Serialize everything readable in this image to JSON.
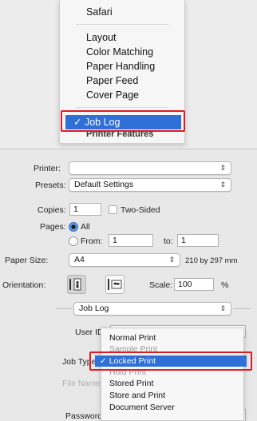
{
  "menu": {
    "items": [
      "Safari",
      "Layout",
      "Color Matching",
      "Paper Handling",
      "Paper Feed",
      "Cover Page"
    ],
    "selected": "Job Log",
    "after": "Printer Features"
  },
  "dialog": {
    "printer_label": "Printer:",
    "printer_value": "",
    "presets_label": "Presets:",
    "presets_value": "Default Settings",
    "copies_label": "Copies:",
    "copies_value": "1",
    "two_sided_label": "Two-Sided",
    "pages_label": "Pages:",
    "pages_all": "All",
    "pages_from_label": "From:",
    "pages_from_value": "1",
    "pages_to_label": "to:",
    "pages_to_value": "1",
    "paper_size_label": "Paper Size:",
    "paper_size_value": "A4",
    "paper_size_dims": "210 by 297 mm",
    "orientation_label": "Orientation:",
    "scale_label": "Scale:",
    "scale_value": "100",
    "scale_unit": "%",
    "section_value": "Job Log",
    "user_id_label": "User ID",
    "job_type_label": "Job Type",
    "file_name_label": "File Name",
    "password_label": "Password"
  },
  "job_type_dropdown": {
    "items": [
      "Normal Print",
      "Sample Print",
      "Locked Print",
      "Hold Print",
      "Stored Print",
      "Store and Print",
      "Document Server"
    ],
    "selected_index": 2
  },
  "colors": {
    "highlight": "#2e6fd8",
    "callout": "#e01b24"
  }
}
